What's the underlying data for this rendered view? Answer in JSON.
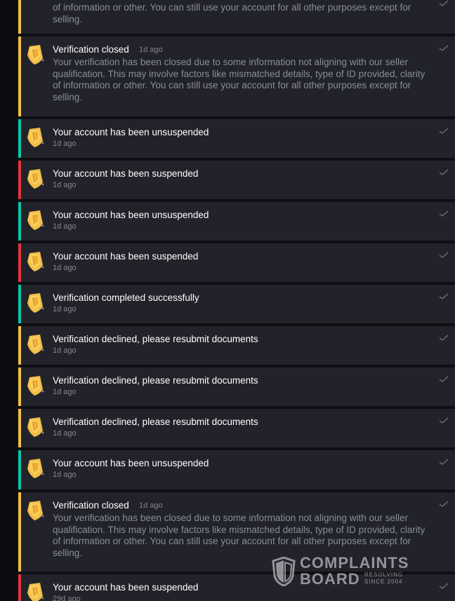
{
  "colors": {
    "background": "#0f1013",
    "card": "#22232a",
    "warning": "#f2bf48",
    "success": "#0cc3a8",
    "danger": "#e4343f",
    "secondary_text": "#8b8d94"
  },
  "icons": {
    "badge": "yellow-shield-badge-icon",
    "read": "checkmark-icon",
    "watermark": "shield-logo-icon"
  },
  "notifications": [
    {
      "type": "warning",
      "title": "",
      "time": "",
      "body": "of information or other. You can still use your account for all other purposes except for\nselling."
    },
    {
      "type": "warning",
      "title": "Verification closed",
      "time": "1d ago",
      "body": "Your verification has been closed due to some information not aligning with our seller\nqualification. This may involve factors like mismatched details, type of ID provided, clarity\nof information or other. You can still use your account for all other purposes except for\nselling."
    },
    {
      "type": "success",
      "title": "Your account has been unsuspended",
      "time": "1d ago",
      "body": ""
    },
    {
      "type": "danger",
      "title": "Your account has been suspended",
      "time": "1d ago",
      "body": ""
    },
    {
      "type": "success",
      "title": "Your account has been unsuspended",
      "time": "1d ago",
      "body": ""
    },
    {
      "type": "danger",
      "title": "Your account has been suspended",
      "time": "1d ago",
      "body": ""
    },
    {
      "type": "success",
      "title": "Verification completed successfully",
      "time": "1d ago",
      "body": ""
    },
    {
      "type": "warning",
      "title": "Verification declined, please resubmit documents",
      "time": "1d ago",
      "body": ""
    },
    {
      "type": "warning",
      "title": "Verification declined, please resubmit documents",
      "time": "1d ago",
      "body": ""
    },
    {
      "type": "warning",
      "title": "Verification declined, please resubmit documents",
      "time": "1d ago",
      "body": ""
    },
    {
      "type": "success",
      "title": "Your account has been unsuspended",
      "time": "1d ago",
      "body": ""
    },
    {
      "type": "warning",
      "title": "Verification closed",
      "time": "1d ago",
      "body": "Your verification has been closed due to some information not aligning with our seller\nqualification. This may involve factors like mismatched details, type of ID provided, clarity\nof information or other. You can still use your account for all other purposes except for\nselling."
    },
    {
      "type": "danger",
      "title": "Your account has been suspended",
      "time": "29d ago",
      "body": ""
    }
  ],
  "watermark": {
    "brand_top": "COMPLAINTS",
    "brand_bottom": "BOARD",
    "tagline_top": "RESOLVING",
    "tagline_bottom": "SINCE 2004"
  }
}
